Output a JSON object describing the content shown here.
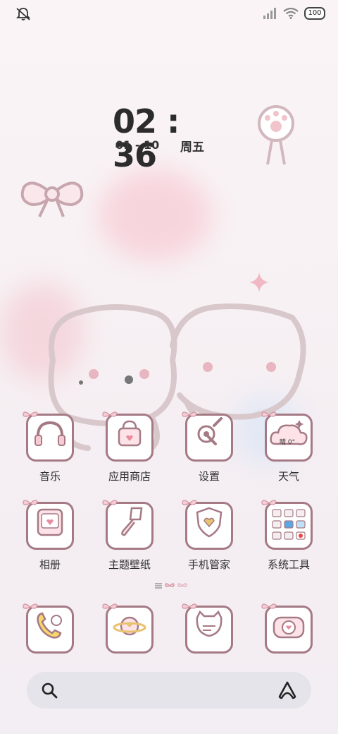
{
  "status_bar": {
    "battery": "100",
    "icons": [
      "notification-mute-icon",
      "signal-icon",
      "wifi-icon",
      "battery-icon"
    ]
  },
  "clock": {
    "time": "02 : 36",
    "date": "01 - 10",
    "weekday": "周五"
  },
  "apps_row1": [
    {
      "label": "音乐",
      "icon": "headphones-icon"
    },
    {
      "label": "应用商店",
      "icon": "shopping-bag-icon"
    },
    {
      "label": "设置",
      "icon": "wrench-gear-icon"
    },
    {
      "label": "天气",
      "icon": "cloud-icon",
      "icon_text": "晴 0°"
    }
  ],
  "apps_row2": [
    {
      "label": "相册",
      "icon": "photo-icon"
    },
    {
      "label": "主题壁纸",
      "icon": "paint-brush-icon"
    },
    {
      "label": "手机管家",
      "icon": "shield-heart-icon"
    },
    {
      "label": "系统工具",
      "icon": "folder-grid-icon"
    }
  ],
  "dock": [
    {
      "icon": "phone-icon"
    },
    {
      "icon": "planet-heart-icon"
    },
    {
      "icon": "chat-cat-icon"
    },
    {
      "icon": "camera-icon"
    }
  ],
  "search": {
    "icon": "search-icon",
    "assistant_icon": "assistant-icon"
  },
  "colors": {
    "accent": "#a57a85",
    "pink": "#f6cbd4",
    "text": "#2f2f2f"
  }
}
